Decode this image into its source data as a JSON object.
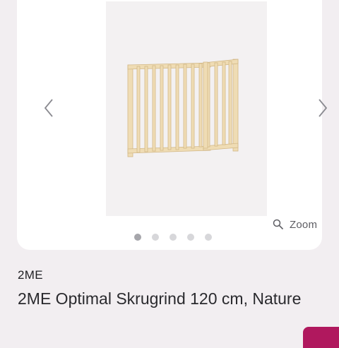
{
  "product": {
    "brand": "2ME",
    "title": "2ME Optimal Skrugrind 120 cm, Nature"
  },
  "gallery": {
    "zoom_label": "Zoom",
    "slide_count": 5,
    "active_slide": 1
  },
  "icons": {
    "prev": "chevron-left-icon",
    "next": "chevron-right-icon",
    "zoom": "magnifier-icon"
  },
  "colors": {
    "accent": "#b0185e",
    "gate_wood": "#efdcb4",
    "dot_active": "#a6a6ab",
    "dot_inactive": "#d7d7da"
  }
}
